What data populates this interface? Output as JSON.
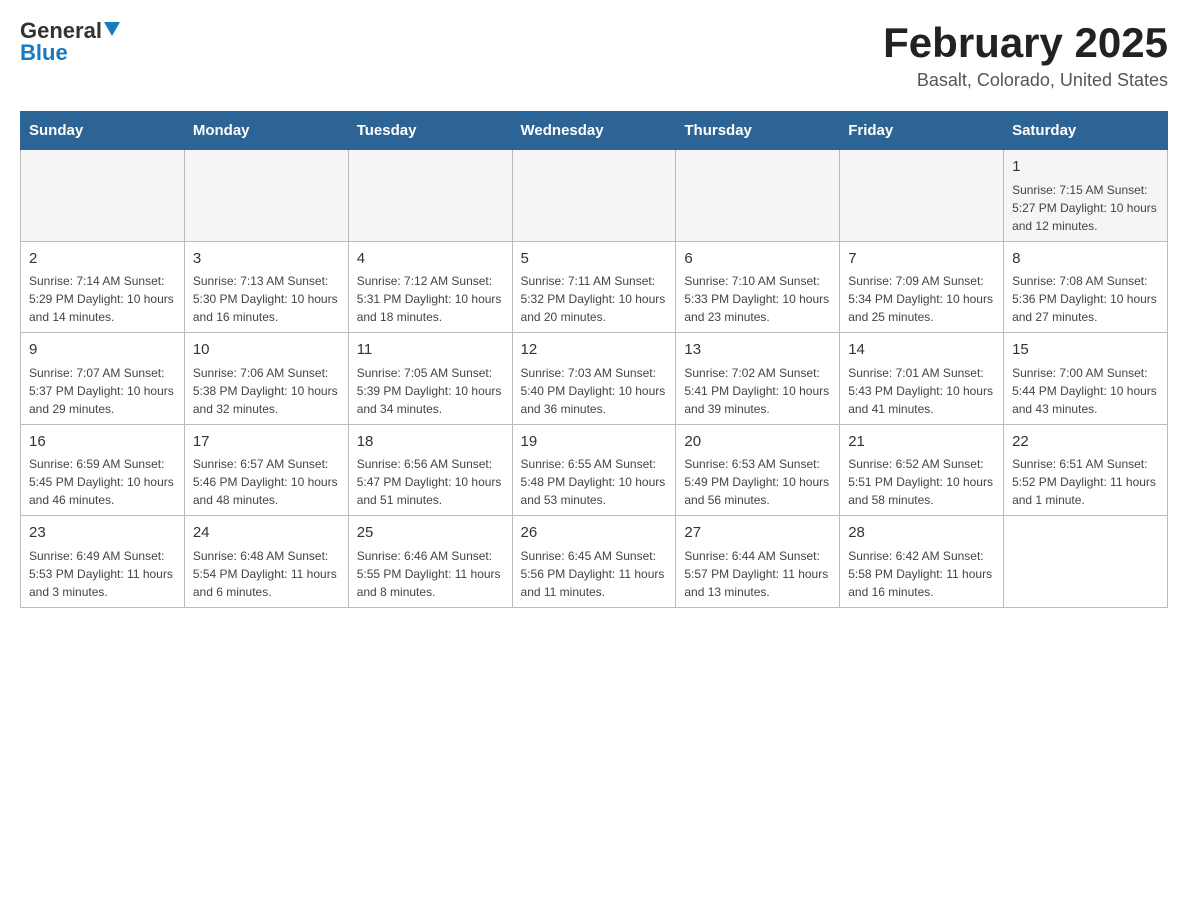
{
  "logo": {
    "general": "General",
    "blue": "Blue"
  },
  "title": {
    "main": "February 2025",
    "sub": "Basalt, Colorado, United States"
  },
  "days": [
    "Sunday",
    "Monday",
    "Tuesday",
    "Wednesday",
    "Thursday",
    "Friday",
    "Saturday"
  ],
  "weeks": [
    [
      {
        "num": "",
        "info": ""
      },
      {
        "num": "",
        "info": ""
      },
      {
        "num": "",
        "info": ""
      },
      {
        "num": "",
        "info": ""
      },
      {
        "num": "",
        "info": ""
      },
      {
        "num": "",
        "info": ""
      },
      {
        "num": "1",
        "info": "Sunrise: 7:15 AM\nSunset: 5:27 PM\nDaylight: 10 hours and 12 minutes."
      }
    ],
    [
      {
        "num": "2",
        "info": "Sunrise: 7:14 AM\nSunset: 5:29 PM\nDaylight: 10 hours and 14 minutes."
      },
      {
        "num": "3",
        "info": "Sunrise: 7:13 AM\nSunset: 5:30 PM\nDaylight: 10 hours and 16 minutes."
      },
      {
        "num": "4",
        "info": "Sunrise: 7:12 AM\nSunset: 5:31 PM\nDaylight: 10 hours and 18 minutes."
      },
      {
        "num": "5",
        "info": "Sunrise: 7:11 AM\nSunset: 5:32 PM\nDaylight: 10 hours and 20 minutes."
      },
      {
        "num": "6",
        "info": "Sunrise: 7:10 AM\nSunset: 5:33 PM\nDaylight: 10 hours and 23 minutes."
      },
      {
        "num": "7",
        "info": "Sunrise: 7:09 AM\nSunset: 5:34 PM\nDaylight: 10 hours and 25 minutes."
      },
      {
        "num": "8",
        "info": "Sunrise: 7:08 AM\nSunset: 5:36 PM\nDaylight: 10 hours and 27 minutes."
      }
    ],
    [
      {
        "num": "9",
        "info": "Sunrise: 7:07 AM\nSunset: 5:37 PM\nDaylight: 10 hours and 29 minutes."
      },
      {
        "num": "10",
        "info": "Sunrise: 7:06 AM\nSunset: 5:38 PM\nDaylight: 10 hours and 32 minutes."
      },
      {
        "num": "11",
        "info": "Sunrise: 7:05 AM\nSunset: 5:39 PM\nDaylight: 10 hours and 34 minutes."
      },
      {
        "num": "12",
        "info": "Sunrise: 7:03 AM\nSunset: 5:40 PM\nDaylight: 10 hours and 36 minutes."
      },
      {
        "num": "13",
        "info": "Sunrise: 7:02 AM\nSunset: 5:41 PM\nDaylight: 10 hours and 39 minutes."
      },
      {
        "num": "14",
        "info": "Sunrise: 7:01 AM\nSunset: 5:43 PM\nDaylight: 10 hours and 41 minutes."
      },
      {
        "num": "15",
        "info": "Sunrise: 7:00 AM\nSunset: 5:44 PM\nDaylight: 10 hours and 43 minutes."
      }
    ],
    [
      {
        "num": "16",
        "info": "Sunrise: 6:59 AM\nSunset: 5:45 PM\nDaylight: 10 hours and 46 minutes."
      },
      {
        "num": "17",
        "info": "Sunrise: 6:57 AM\nSunset: 5:46 PM\nDaylight: 10 hours and 48 minutes."
      },
      {
        "num": "18",
        "info": "Sunrise: 6:56 AM\nSunset: 5:47 PM\nDaylight: 10 hours and 51 minutes."
      },
      {
        "num": "19",
        "info": "Sunrise: 6:55 AM\nSunset: 5:48 PM\nDaylight: 10 hours and 53 minutes."
      },
      {
        "num": "20",
        "info": "Sunrise: 6:53 AM\nSunset: 5:49 PM\nDaylight: 10 hours and 56 minutes."
      },
      {
        "num": "21",
        "info": "Sunrise: 6:52 AM\nSunset: 5:51 PM\nDaylight: 10 hours and 58 minutes."
      },
      {
        "num": "22",
        "info": "Sunrise: 6:51 AM\nSunset: 5:52 PM\nDaylight: 11 hours and 1 minute."
      }
    ],
    [
      {
        "num": "23",
        "info": "Sunrise: 6:49 AM\nSunset: 5:53 PM\nDaylight: 11 hours and 3 minutes."
      },
      {
        "num": "24",
        "info": "Sunrise: 6:48 AM\nSunset: 5:54 PM\nDaylight: 11 hours and 6 minutes."
      },
      {
        "num": "25",
        "info": "Sunrise: 6:46 AM\nSunset: 5:55 PM\nDaylight: 11 hours and 8 minutes."
      },
      {
        "num": "26",
        "info": "Sunrise: 6:45 AM\nSunset: 5:56 PM\nDaylight: 11 hours and 11 minutes."
      },
      {
        "num": "27",
        "info": "Sunrise: 6:44 AM\nSunset: 5:57 PM\nDaylight: 11 hours and 13 minutes."
      },
      {
        "num": "28",
        "info": "Sunrise: 6:42 AM\nSunset: 5:58 PM\nDaylight: 11 hours and 16 minutes."
      },
      {
        "num": "",
        "info": ""
      }
    ]
  ]
}
